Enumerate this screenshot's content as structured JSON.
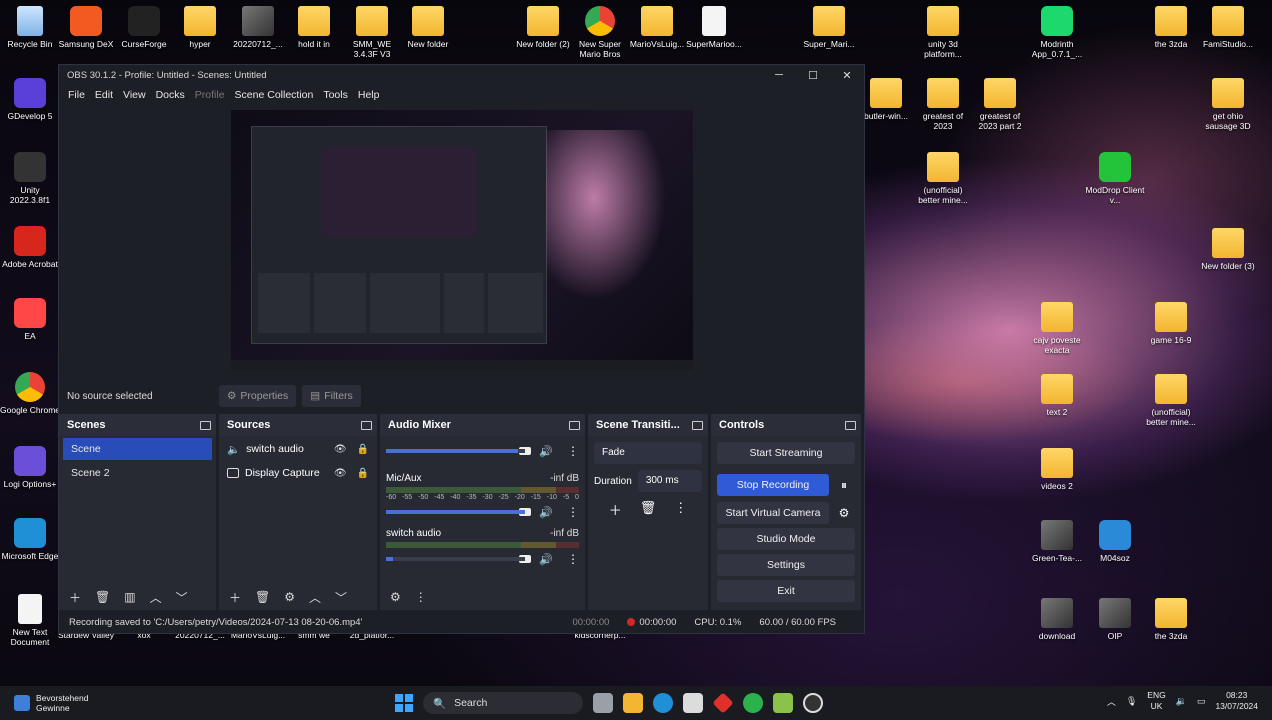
{
  "desktop": {
    "icons": [
      {
        "label": "Recycle Bin",
        "kind": "recycle"
      },
      {
        "label": "Samsung DeX",
        "kind": "app",
        "color": "#f25a22"
      },
      {
        "label": "CurseForge",
        "kind": "app",
        "color": "#222222"
      },
      {
        "label": "hyper",
        "kind": "folder"
      },
      {
        "label": "20220712_...",
        "kind": "thumb"
      },
      {
        "label": "hold it in",
        "kind": "folder"
      },
      {
        "label": "SMM_WE 3.4.3F V3",
        "kind": "folder"
      },
      {
        "label": "New folder",
        "kind": "folder"
      },
      {
        "label": "New folder (2)",
        "kind": "folder"
      },
      {
        "label": "New Super Mario Bros",
        "kind": "chrome"
      },
      {
        "label": "MarioVsLuig...",
        "kind": "folder"
      },
      {
        "label": "SuperMarioo...",
        "kind": "doc"
      },
      {
        "label": "Super_Mari...",
        "kind": "folder"
      },
      {
        "label": "unity 3d platform...",
        "kind": "folder"
      },
      {
        "label": "Modrinth App_0.7.1_...",
        "kind": "app",
        "color": "#1bd96a"
      },
      {
        "label": "the 3zda",
        "kind": "folder"
      },
      {
        "label": "FamiStudio...",
        "kind": "folder"
      },
      {
        "label": "GDevelop 5",
        "kind": "app",
        "color": "#5a3fd8"
      },
      {
        "label": "Unity 2022.3.8f1",
        "kind": "app",
        "color": "#333333"
      },
      {
        "label": "Adobe Acrobat",
        "kind": "app",
        "color": "#d7261c"
      },
      {
        "label": "EA",
        "kind": "app",
        "color": "#ff4747"
      },
      {
        "label": "Google Chrome",
        "kind": "chrome"
      },
      {
        "label": "Logi Options+",
        "kind": "app",
        "color": "#6b4fd8"
      },
      {
        "label": "Microsoft Edge",
        "kind": "app",
        "color": "#1f8fd6"
      },
      {
        "label": "New Text Document",
        "kind": "doc"
      },
      {
        "label": "butler-win...",
        "kind": "folder"
      },
      {
        "label": "greatest of 2023",
        "kind": "folder"
      },
      {
        "label": "greatest of 2023 part 2",
        "kind": "folder"
      },
      {
        "label": "get ohio sausage 3D",
        "kind": "folder"
      },
      {
        "label": "(unofficial) better mine...",
        "kind": "folder"
      },
      {
        "label": "ModDrop Client v...",
        "kind": "app",
        "color": "#23c43a"
      },
      {
        "label": "New folder (3)",
        "kind": "folder"
      },
      {
        "label": "cajv poveste exacta",
        "kind": "folder"
      },
      {
        "label": "game 16-9",
        "kind": "folder"
      },
      {
        "label": "text 2",
        "kind": "folder"
      },
      {
        "label": "(unofficial) better mine...",
        "kind": "folder"
      },
      {
        "label": "videos 2",
        "kind": "folder"
      },
      {
        "label": "Green-Tea-...",
        "kind": "thumb"
      },
      {
        "label": "M04soz",
        "kind": "app",
        "color": "#2a8ad8"
      },
      {
        "label": "download",
        "kind": "thumb"
      },
      {
        "label": "OIP",
        "kind": "thumb"
      },
      {
        "label": "the 3zda",
        "kind": "folder"
      },
      {
        "label": "Stardew Valley",
        "kind": "hidden"
      },
      {
        "label": "xox",
        "kind": "hidden"
      },
      {
        "label": "20220712_...",
        "kind": "hidden"
      },
      {
        "label": "MarioVsLuig...",
        "kind": "hidden"
      },
      {
        "label": "smm we",
        "kind": "hidden"
      },
      {
        "label": "2d_platfor...",
        "kind": "hidden"
      },
      {
        "label": "kidscornerp...",
        "kind": "hidden"
      }
    ]
  },
  "obs": {
    "title": "OBS 30.1.2 - Profile: Untitled - Scenes: Untitled",
    "window_buttons": {
      "minimize": "─",
      "maximize": "☐",
      "close": "✕"
    },
    "menu": [
      "File",
      "Edit",
      "View",
      "Docks",
      "Profile",
      "Scene Collection",
      "Tools",
      "Help"
    ],
    "source_bar": {
      "no_source": "No source selected",
      "properties": "Properties",
      "filters": "Filters"
    },
    "scenes": {
      "title": "Scenes",
      "items": [
        "Scene",
        "Scene 2"
      ],
      "selected": 0
    },
    "sources": {
      "title": "Sources",
      "items": [
        {
          "name": "switch audio",
          "icon": "speaker-icon"
        },
        {
          "name": "Display Capture",
          "icon": "monitor-icon"
        }
      ]
    },
    "audio_mixer": {
      "title": "Audio Mixer",
      "channels": [
        {
          "name": "Mic/Aux",
          "db": "-inf dB",
          "volume": 1.0
        },
        {
          "name": "switch audio",
          "db": "-inf dB",
          "volume": 0.05
        }
      ],
      "top_channel_volume": 0.95,
      "scale": [
        "-60",
        "-55",
        "-50",
        "-45",
        "-40",
        "-35",
        "-30",
        "-25",
        "-20",
        "-15",
        "-10",
        "-5",
        "0"
      ]
    },
    "transitions": {
      "title": "Scene Transiti...",
      "selected": "Fade",
      "duration_label": "Duration",
      "duration_value": "300 ms"
    },
    "controls": {
      "title": "Controls",
      "start_streaming": "Start Streaming",
      "stop_recording": "Stop Recording",
      "start_virtual_camera": "Start Virtual Camera",
      "studio_mode": "Studio Mode",
      "settings": "Settings",
      "exit": "Exit"
    },
    "status": {
      "message": "Recording saved to 'C:/Users/petry/Videos/2024-07-13 08-20-06.mp4'",
      "stream_time": "00:00:00",
      "rec_time": "00:00:00",
      "cpu": "CPU: 0.1%",
      "fps": "60.00 / 60.00 FPS"
    }
  },
  "taskbar": {
    "news_title": "Bevorstehend",
    "news_sub": "Gewinne",
    "search_placeholder": "Search",
    "lang_1": "ENG",
    "lang_2": "UK",
    "time": "08:23",
    "date": "13/07/2024"
  }
}
